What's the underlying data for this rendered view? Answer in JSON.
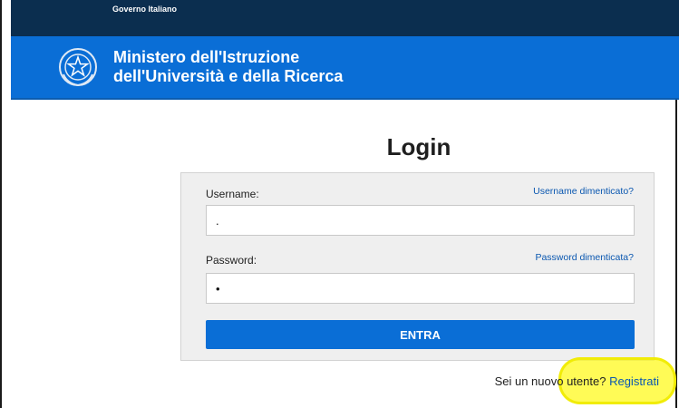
{
  "header": {
    "gov_label": "Governo Italiano",
    "ministry_line1": "Ministero dell'Istruzione",
    "ministry_line2": "dell'Università e della Ricerca",
    "emblem_icon": "italian-republic-emblem-icon"
  },
  "login": {
    "title": "Login",
    "username_label": "Username:",
    "username_forgot": "Username dimenticato?",
    "username_value": ".",
    "password_label": "Password:",
    "password_forgot": "Password dimenticata?",
    "password_value": "•",
    "submit_label": "ENTRA"
  },
  "register": {
    "prompt": "Sei un nuovo utente?",
    "link_label": "Registrati"
  },
  "colors": {
    "gov_bar": "#0b2e4f",
    "ministry_bar": "#0a6ed6",
    "link": "#0a57b0",
    "highlight": "#fff21e"
  }
}
